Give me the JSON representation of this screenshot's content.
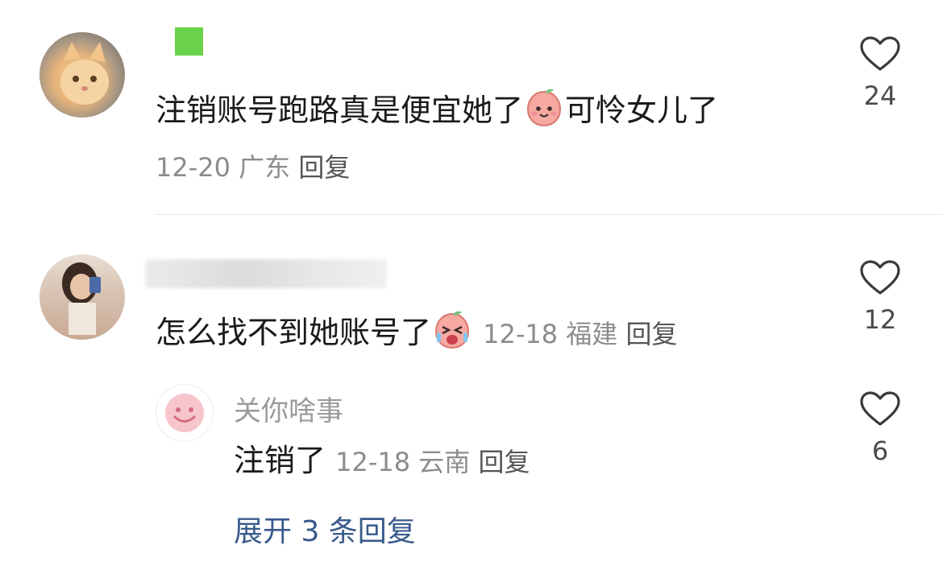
{
  "comments": [
    {
      "text_before_emoji": "注销账号跑路真是便宜她了",
      "text_after_emoji": "可怜女儿了",
      "emoji": "smiling-peach-emoji",
      "date": "12-20",
      "location": "广东",
      "reply_label": "回复",
      "likes": "24"
    },
    {
      "text": "怎么找不到她账号了",
      "emoji": "crying-peach-emoji",
      "date": "12-18",
      "location": "福建",
      "reply_label": "回复",
      "likes": "12",
      "replies": [
        {
          "username": "关你啥事",
          "text": "注销了",
          "date": "12-18",
          "location": "云南",
          "reply_label": "回复",
          "likes": "6"
        }
      ],
      "expand_label": "展开 3 条回复"
    }
  ],
  "icons": {
    "like": "heart-outline-icon"
  },
  "colors": {
    "link": "#3a5a8c",
    "meta": "#8c8c8c"
  }
}
